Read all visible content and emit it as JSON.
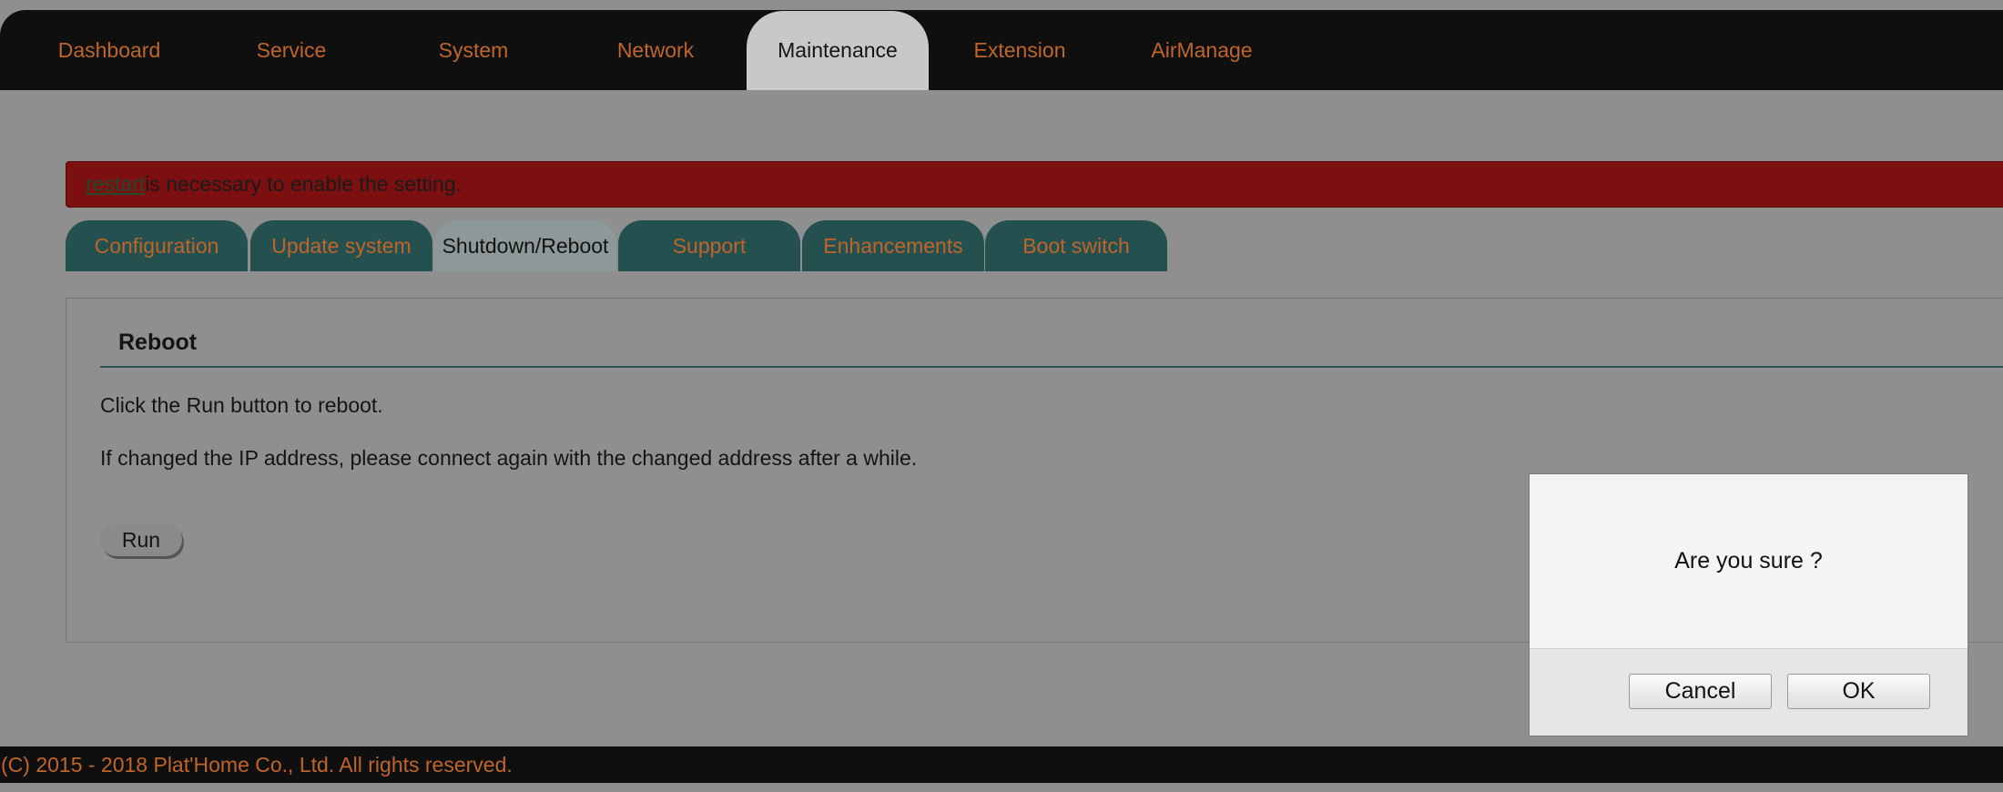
{
  "nav": {
    "items": [
      {
        "label": "Dashboard"
      },
      {
        "label": "Service"
      },
      {
        "label": "System"
      },
      {
        "label": "Network"
      },
      {
        "label": "Maintenance",
        "active": true
      },
      {
        "label": "Extension"
      },
      {
        "label": "AirManage"
      }
    ]
  },
  "alert": {
    "link_text": "restart ",
    "message": "is necessary to enable the setting."
  },
  "subtabs": [
    {
      "label": "Configuration"
    },
    {
      "label": "Update system"
    },
    {
      "label": "Shutdown/Reboot",
      "active": true
    },
    {
      "label": "Support"
    },
    {
      "label": "Enhancements"
    },
    {
      "label": "Boot switch"
    }
  ],
  "reboot": {
    "title": "Reboot",
    "instruction": "Click the Run button to reboot.",
    "note": "If changed the IP address, please connect again with the changed address after a while.",
    "run_label": "Run"
  },
  "dialog": {
    "message": "Are you sure ?",
    "cancel_label": "Cancel",
    "ok_label": "OK"
  },
  "footer": {
    "copyright": "(C) 2015 - 2018 Plat'Home Co., Ltd. All rights reserved."
  },
  "colors": {
    "accent_text": "#c0652a",
    "alert_bg": "#7c1010",
    "tab_bg": "#245050",
    "overlay_bg": "#8f8f8f"
  }
}
